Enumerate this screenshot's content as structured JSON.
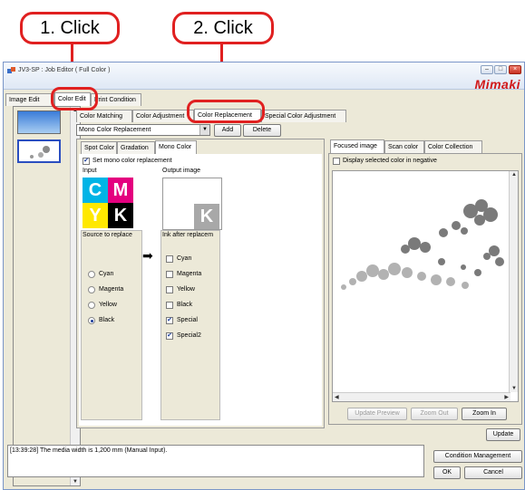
{
  "callouts": {
    "first": "1. Click",
    "second": "2. Click"
  },
  "window": {
    "title": "JV3-SP : Job Editor ( Full Color )",
    "brand": "Mimaki",
    "btn_min": "–",
    "btn_max": "□",
    "btn_close": "×"
  },
  "main_tabs": [
    "Image Edit",
    "Color Edit",
    "Print Condition"
  ],
  "sub_tabs": [
    "Color Matching",
    "Color Adjustment",
    "Color Replacement",
    "Special Color Adjustment"
  ],
  "replacement": {
    "mode": "Mono Color Replacement",
    "add": "Add",
    "delete": "Delete"
  },
  "left_tabs": [
    "Spot Color",
    "Gradation",
    "Mono Color"
  ],
  "mono": {
    "set_label": "Set mono color replacement",
    "input_label": "Input",
    "output_label": "Output image",
    "source_label": "Source to replace",
    "ink_label": "Ink after replacem",
    "cmyk": [
      "C",
      "M",
      "Y",
      "K"
    ],
    "output_letter": "K",
    "sources": [
      "Cyan",
      "Magenta",
      "Yellow",
      "Black"
    ],
    "selected_source": "Black",
    "inks": [
      "Cyan",
      "Magenta",
      "Yellow",
      "Black",
      "Special",
      "Special2"
    ],
    "checked_inks": [
      "Special",
      "Special2"
    ],
    "arrow": "➡"
  },
  "right_tabs": [
    "Focused image",
    "Scan color",
    "Color Collection"
  ],
  "preview": {
    "negative_label": "Display selected color in negative",
    "update_preview": "Update Preview",
    "zoom_out": "Zoom Out",
    "zoom_in": "Zoom In",
    "update": "Update"
  },
  "log": {
    "message": "[13:39:28] The media width is 1,200 mm (Manual Input)."
  },
  "actions": {
    "condition": "Condition Management",
    "ok": "OK",
    "cancel": "Cancel"
  },
  "colors": {
    "accent_red": "#e02020",
    "cyan": "#00b4e6",
    "magenta": "#e4007f",
    "yellow": "#ffe800",
    "black": "#000000"
  }
}
